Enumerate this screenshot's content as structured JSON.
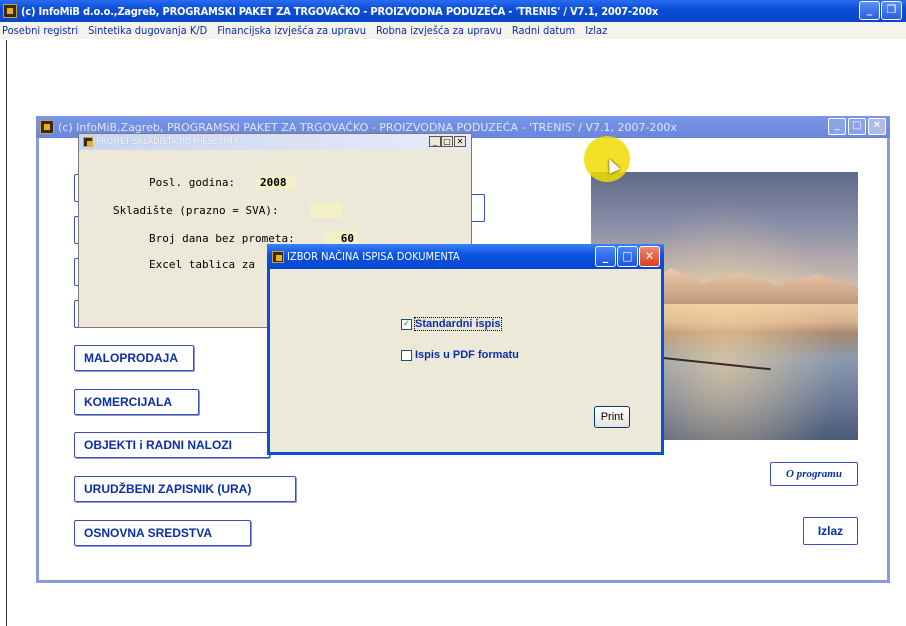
{
  "app": {
    "title": "(c) InfoMiB d.o.o.,Zagreb, PROGRAMSKI PAKET ZA TRGOVAČKO - PROIZVODNA PODUZEĆA - 'TRENIS' / V7.1, 2007-200x",
    "menu": [
      "Posebni registri",
      "Sintetika dugovanja K/D",
      "Financijska izvješća za upravu",
      "Robna izvješća za upravu",
      "Radni datum",
      "Izlaz"
    ]
  },
  "main_window": {
    "title": "(c) InfoMiB,Zagreb, PROGRAMSKI PAKET ZA TRGOVAČKO - PROIZVODNA PODUZEĆA - 'TRENIS' / V7.1, 2007-200x",
    "buttons": [
      "MALOPRODAJA",
      "KOMERCIJALA",
      "OBJEKTI i RADNI NALOZI",
      "URUDŽBENI ZAPISNIK (URA)",
      "OSNOVNA SREDSTVA"
    ],
    "about_label": "O programu",
    "exit_label": "Izlaz"
  },
  "promet_dialog": {
    "title": "PROMET SKLADIŠTA PO MJESECIMA",
    "rows": [
      {
        "label": "Posl. godina:",
        "value": "2008"
      },
      {
        "label": "Skladište (prazno = SVA):",
        "value": ""
      },
      {
        "label": "Broj dana bez prometa:",
        "value": "60"
      },
      {
        "label": "Excel tablica za",
        "value": ""
      }
    ]
  },
  "izbor_dialog": {
    "title": "IZBOR NAČINA ISPISA DOKUMENTA",
    "options": [
      {
        "label": "Standardni ispis",
        "checked": true
      },
      {
        "label": "Ispis u PDF formatu",
        "checked": false
      }
    ],
    "print_label": "Print"
  },
  "colors": {
    "accent": "#0a2ea8",
    "titlebar": "#0a4fd8",
    "dialog_bg": "#ece9d8"
  }
}
